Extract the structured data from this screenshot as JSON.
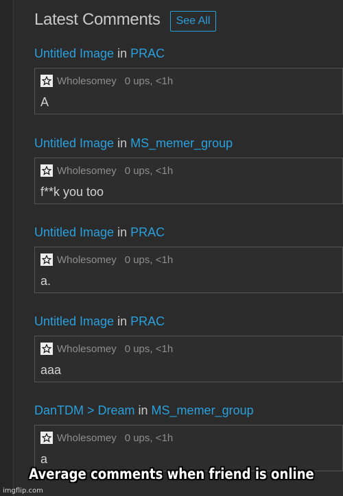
{
  "header": {
    "title": "Latest Comments",
    "see_all_label": "See All"
  },
  "comments": [
    {
      "image_title": "Untitled Image",
      "connector": " in ",
      "stream": "PRAC",
      "username": "Wholesomey",
      "ups": "0 ups, <1h",
      "text": "A"
    },
    {
      "image_title": "Untitled Image",
      "connector": " in ",
      "stream": "MS_memer_group",
      "username": "Wholesomey",
      "ups": "0 ups, <1h",
      "text": "f**k you too"
    },
    {
      "image_title": "Untitled Image",
      "connector": " in ",
      "stream": "PRAC",
      "username": "Wholesomey",
      "ups": "0 ups, <1h",
      "text": "a."
    },
    {
      "image_title": "Untitled Image",
      "connector": " in ",
      "stream": "PRAC",
      "username": "Wholesomey",
      "ups": "0 ups, <1h",
      "text": "aaa"
    },
    {
      "image_title": "DanTDM > Dream",
      "connector": " in ",
      "stream": "MS_memer_group",
      "username": "Wholesomey",
      "ups": "0 ups, <1h",
      "text": "a"
    }
  ],
  "meme_caption": "Average comments when friend is online",
  "watermark": "imgflip.com",
  "colors": {
    "background": "#2b2b2b",
    "link": "#2aa0dd",
    "muted_text": "#8e8e8e"
  },
  "icons": {
    "user_badge": "star-icon"
  }
}
